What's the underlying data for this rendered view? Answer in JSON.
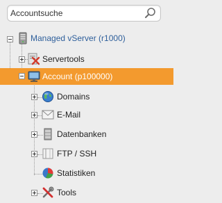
{
  "search": {
    "value": "Accountsuche"
  },
  "tree": {
    "root": {
      "label": "Managed vServer (r1000)",
      "icon": "server-icon"
    },
    "servertools": {
      "label": "Servertools",
      "icon": "servertools-icon"
    },
    "account": {
      "label": "Account (p100000)",
      "icon": "monitor-icon",
      "selected": true
    },
    "children": [
      {
        "label": "Domains",
        "icon": "globe-icon"
      },
      {
        "label": "E-Mail",
        "icon": "envelope-icon"
      },
      {
        "label": "Datenbanken",
        "icon": "database-icon"
      },
      {
        "label": "FTP / SSH",
        "icon": "folder-icon"
      },
      {
        "label": "Statistiken",
        "icon": "pie-chart-icon"
      },
      {
        "label": "Tools",
        "icon": "tools-icon"
      }
    ]
  },
  "colors": {
    "selected": "#f39a2e",
    "link": "#2e5f9b"
  }
}
